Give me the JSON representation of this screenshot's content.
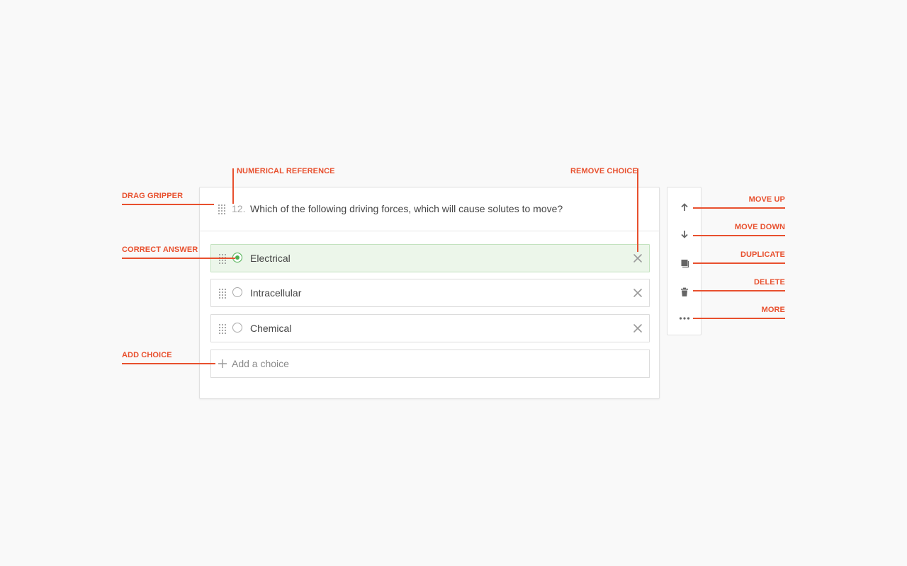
{
  "question": {
    "number": "12.",
    "text": "Which of the following driving forces, which will cause solutes to move?"
  },
  "choices": [
    {
      "label": "Electrical",
      "correct": true
    },
    {
      "label": "Intracellular",
      "correct": false
    },
    {
      "label": "Chemical",
      "correct": false
    }
  ],
  "add_choice": {
    "label": "Add a choice"
  },
  "toolbar": {
    "icons": [
      "arrow-up-icon",
      "arrow-down-icon",
      "duplicate-icon",
      "trash-icon",
      "more-icon"
    ]
  },
  "annotations": {
    "drag_gripper": "DRAG GRIPPER",
    "numerical_reference": "NUMERICAL REFERENCE",
    "remove_choice": "REMOVE CHOICE",
    "correct_answer": "CORRECT ANSWER",
    "add_choice": "ADD CHOICE",
    "move_up": "MOVE UP",
    "move_down": "MOVE DOWN",
    "duplicate": "DUPLICATE",
    "delete": "DELETE",
    "more": "MORE"
  },
  "colors": {
    "annotation": "#e8502e",
    "correct_fill": "#ecf6ea",
    "correct_radio": "#4caf50"
  }
}
